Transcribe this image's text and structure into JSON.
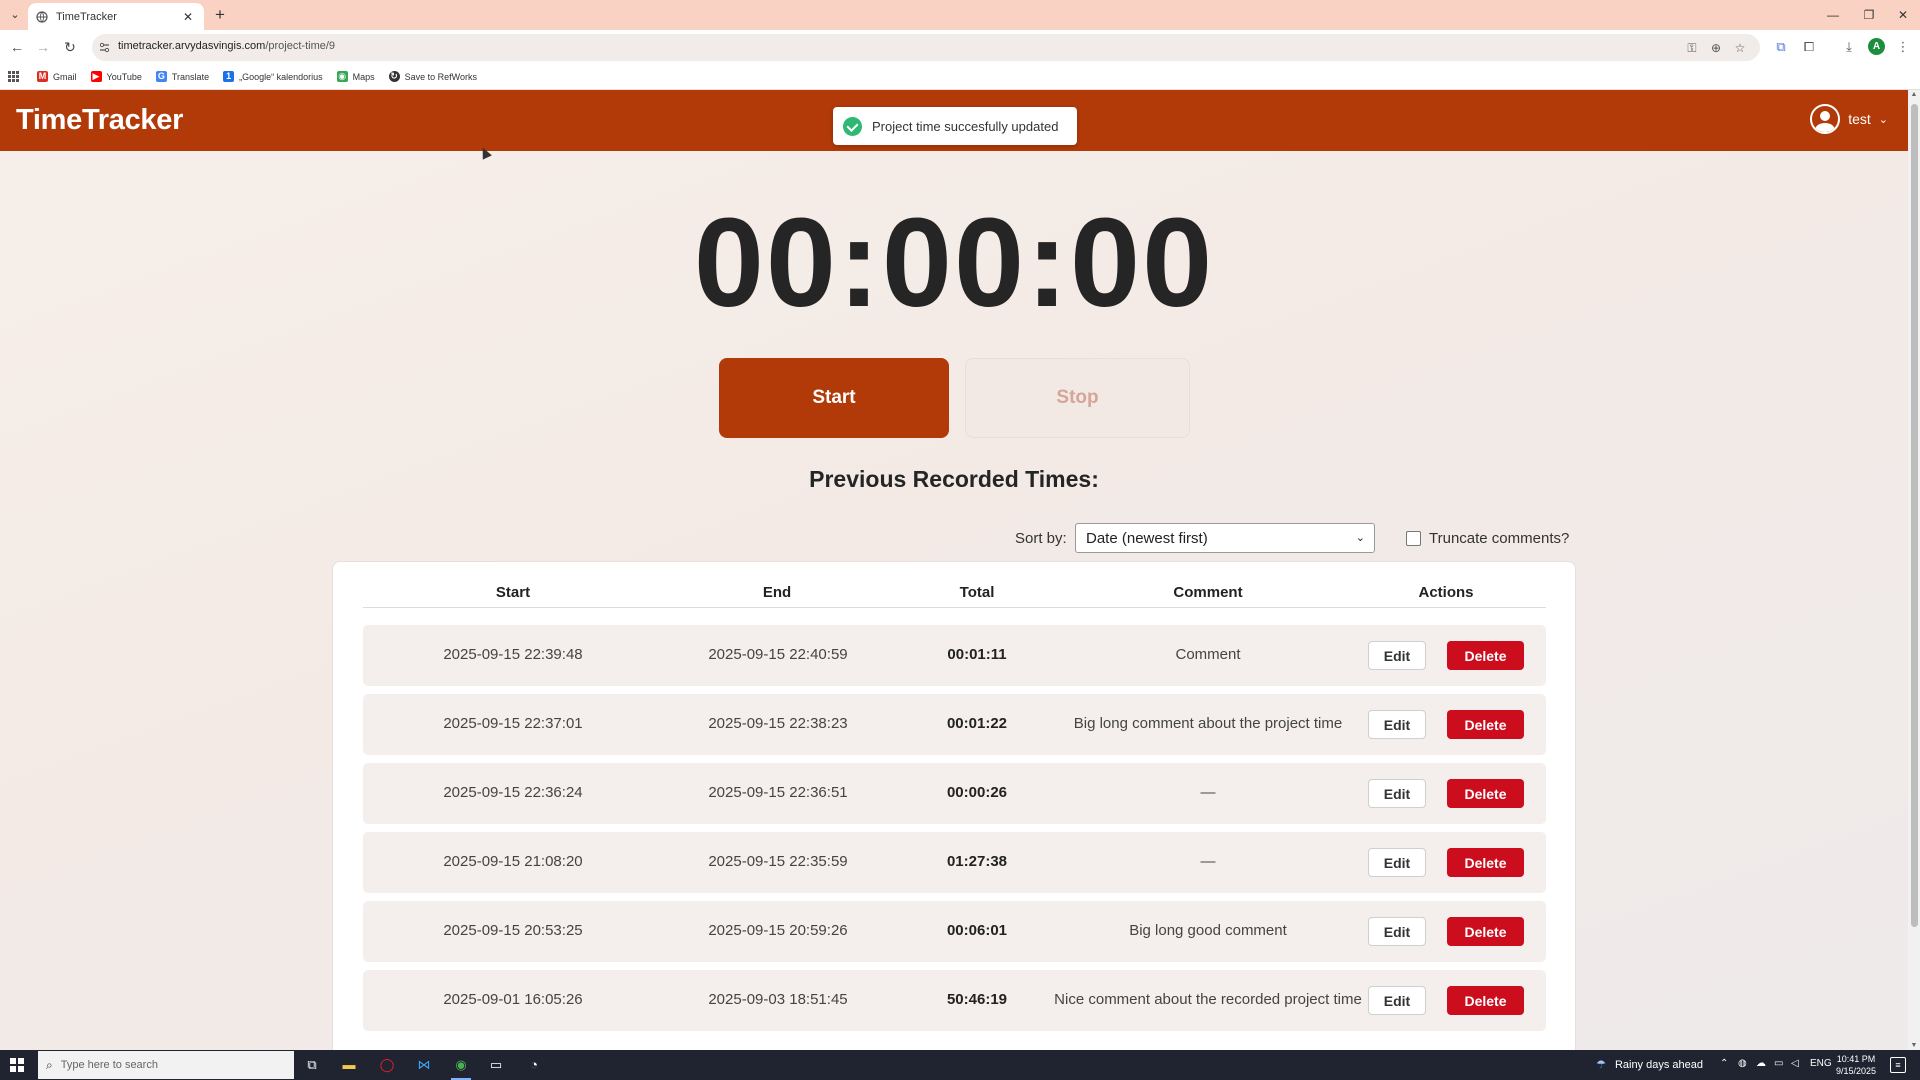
{
  "browser": {
    "tab_title": "TimeTracker",
    "url_host": "timetracker.arvydasvingis.com",
    "url_path": "/project-time/9",
    "bookmarks": [
      {
        "label": "Gmail",
        "color": "#d93025",
        "icon": "gmail-icon"
      },
      {
        "label": "YouTube",
        "color": "#ff0000",
        "icon": "youtube-icon"
      },
      {
        "label": "Translate",
        "color": "#4285f4",
        "icon": "translate-icon"
      },
      {
        "label": "„Google“ kalendorius",
        "color": "#1a73e8",
        "icon": "calendar-icon"
      },
      {
        "label": "Maps",
        "color": "#34a853",
        "icon": "maps-icon"
      },
      {
        "label": "Save to RefWorks",
        "color": "#333333",
        "icon": "refworks-icon"
      }
    ],
    "profile_initial": "A"
  },
  "app": {
    "logo": "TimeTracker",
    "user": "test",
    "toast": "Project time succesfully updated",
    "timer": "00:00:00",
    "start_label": "Start",
    "stop_label": "Stop",
    "section_title": "Previous Recorded Times:",
    "sort_label": "Sort by:",
    "sort_value": "Date (newest first)",
    "truncate_label": "Truncate comments?",
    "truncate_checked": false,
    "columns": [
      "Start",
      "End",
      "Total",
      "Comment",
      "Actions"
    ],
    "edit_label": "Edit",
    "delete_label": "Delete",
    "rows": [
      {
        "start": "2025-09-15 22:39:48",
        "end": "2025-09-15 22:40:59",
        "total": "00:01:11",
        "comment": "Comment"
      },
      {
        "start": "2025-09-15 22:37:01",
        "end": "2025-09-15 22:38:23",
        "total": "00:01:22",
        "comment": "Big long comment about the project time"
      },
      {
        "start": "2025-09-15 22:36:24",
        "end": "2025-09-15 22:36:51",
        "total": "00:00:26",
        "comment": "—"
      },
      {
        "start": "2025-09-15 21:08:20",
        "end": "2025-09-15 22:35:59",
        "total": "01:27:38",
        "comment": "—"
      },
      {
        "start": "2025-09-15 20:53:25",
        "end": "2025-09-15 20:59:26",
        "total": "00:06:01",
        "comment": "Big long good comment"
      },
      {
        "start": "2025-09-01 16:05:26",
        "end": "2025-09-03 18:51:45",
        "total": "50:46:19",
        "comment": "Nice comment about the recorded project time"
      }
    ]
  },
  "colors": {
    "brand": "#b23a08",
    "delete": "#cc0d1e",
    "toast_ok": "#2eb872"
  },
  "taskbar": {
    "search_placeholder": "Type here to search",
    "weather": "Rainy days ahead",
    "language": "ENG",
    "time": "10:41 PM",
    "date": "9/15/2025"
  }
}
